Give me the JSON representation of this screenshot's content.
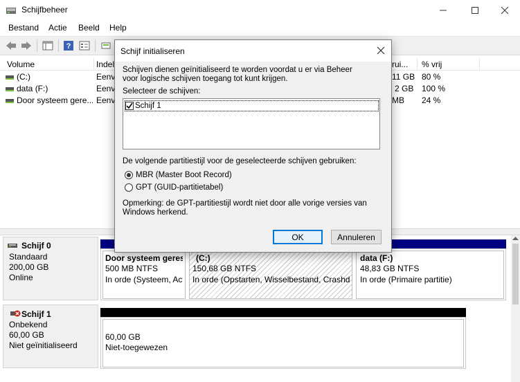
{
  "window": {
    "title": "Schijfbeheer",
    "minimize_icon": "minimize-icon",
    "maximize_icon": "maximize-icon",
    "close_icon": "close-icon"
  },
  "menu": [
    "Bestand",
    "Actie",
    "Beeld",
    "Help"
  ],
  "volume_list": {
    "columns": [
      "Volume",
      "Indel",
      "rui...",
      "% vrij"
    ],
    "rows": [
      {
        "volume": "(C:)",
        "layout": "Eenv",
        "capacity": "11 GB",
        "free_pct": "80 %"
      },
      {
        "volume": "data (F:)",
        "layout": "Eenv",
        "capacity": "2 GB",
        "free_pct": "100 %"
      },
      {
        "volume": "Door systeem gere...",
        "layout": "Eenv",
        "capacity": "MB",
        "free_pct": "24 %"
      }
    ]
  },
  "disks": [
    {
      "name": "Schijf 0",
      "type": "Standaard",
      "size": "200,00 GB",
      "status": "Online",
      "bar_color": "#000080",
      "partitions": [
        {
          "name": "Door systeem geres",
          "size": "500 MB NTFS",
          "status": "In orde (Systeem, Act"
        },
        {
          "name": "(C:)",
          "size": "150,68 GB NTFS",
          "status": "In orde (Opstarten, Wisselbestand, Crashdu"
        },
        {
          "name": "data  (F:)",
          "size": "48,83 GB NTFS",
          "status": "In orde (Primaire partitie)"
        }
      ]
    },
    {
      "name": "Schijf 1",
      "type": "Onbekend",
      "size": "60,00 GB",
      "status": "Niet geïnitialiseerd",
      "bar_color": "#000000",
      "partitions": [
        {
          "size": "60,00 GB",
          "status": "Niet-toegewezen"
        }
      ]
    }
  ],
  "dialog": {
    "title": "Schijf initialiseren",
    "intro": "Schijven dienen geïnitialiseerd te worden voordat u er via Beheer voor logische schijven toegang tot kunt krijgen.",
    "select_label": "Selecteer de schijven:",
    "disk_item": "Schijf 1",
    "disk_item_checked": true,
    "partition_style_label": "De volgende partitiestijl voor de geselecteerde schijven gebruiken:",
    "options": [
      {
        "label": "MBR (Master Boot Record)",
        "selected": true
      },
      {
        "label": "GPT (GUID-partitietabel)",
        "selected": false
      }
    ],
    "note": "Opmerking: de GPT-partitiestijl wordt niet door alle vorige versies van Windows herkend.",
    "ok": "OK",
    "cancel": "Annuleren"
  },
  "colors": {
    "primary_partition_bar": "#000080",
    "unallocated_bar": "#000000",
    "default_button_border": "#0078d7"
  }
}
